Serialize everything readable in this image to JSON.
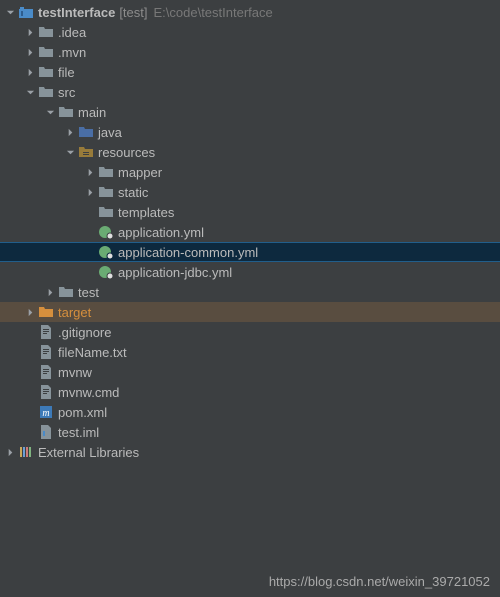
{
  "root": {
    "name": "testInterface",
    "bracket": "[test]",
    "path": "E:\\code\\testInterface"
  },
  "tree": {
    "idea": ".idea",
    "mvn": ".mvn",
    "file": "file",
    "src": "src",
    "main": "main",
    "java": "java",
    "resources": "resources",
    "mapper": "mapper",
    "static": "static",
    "templates": "templates",
    "app_yml": "application.yml",
    "app_common_yml": "application-common.yml",
    "app_jdbc_yml": "application-jdbc.yml",
    "test": "test",
    "target": "target",
    "gitignore": ".gitignore",
    "fileNameTxt": "fileName.txt",
    "mvnw": "mvnw",
    "mvnwCmd": "mvnw.cmd",
    "pomXml": "pom.xml",
    "testIml": "test.iml"
  },
  "externalLibraries": "External Libraries",
  "watermark": "https://blog.csdn.net/weixin_39721052"
}
